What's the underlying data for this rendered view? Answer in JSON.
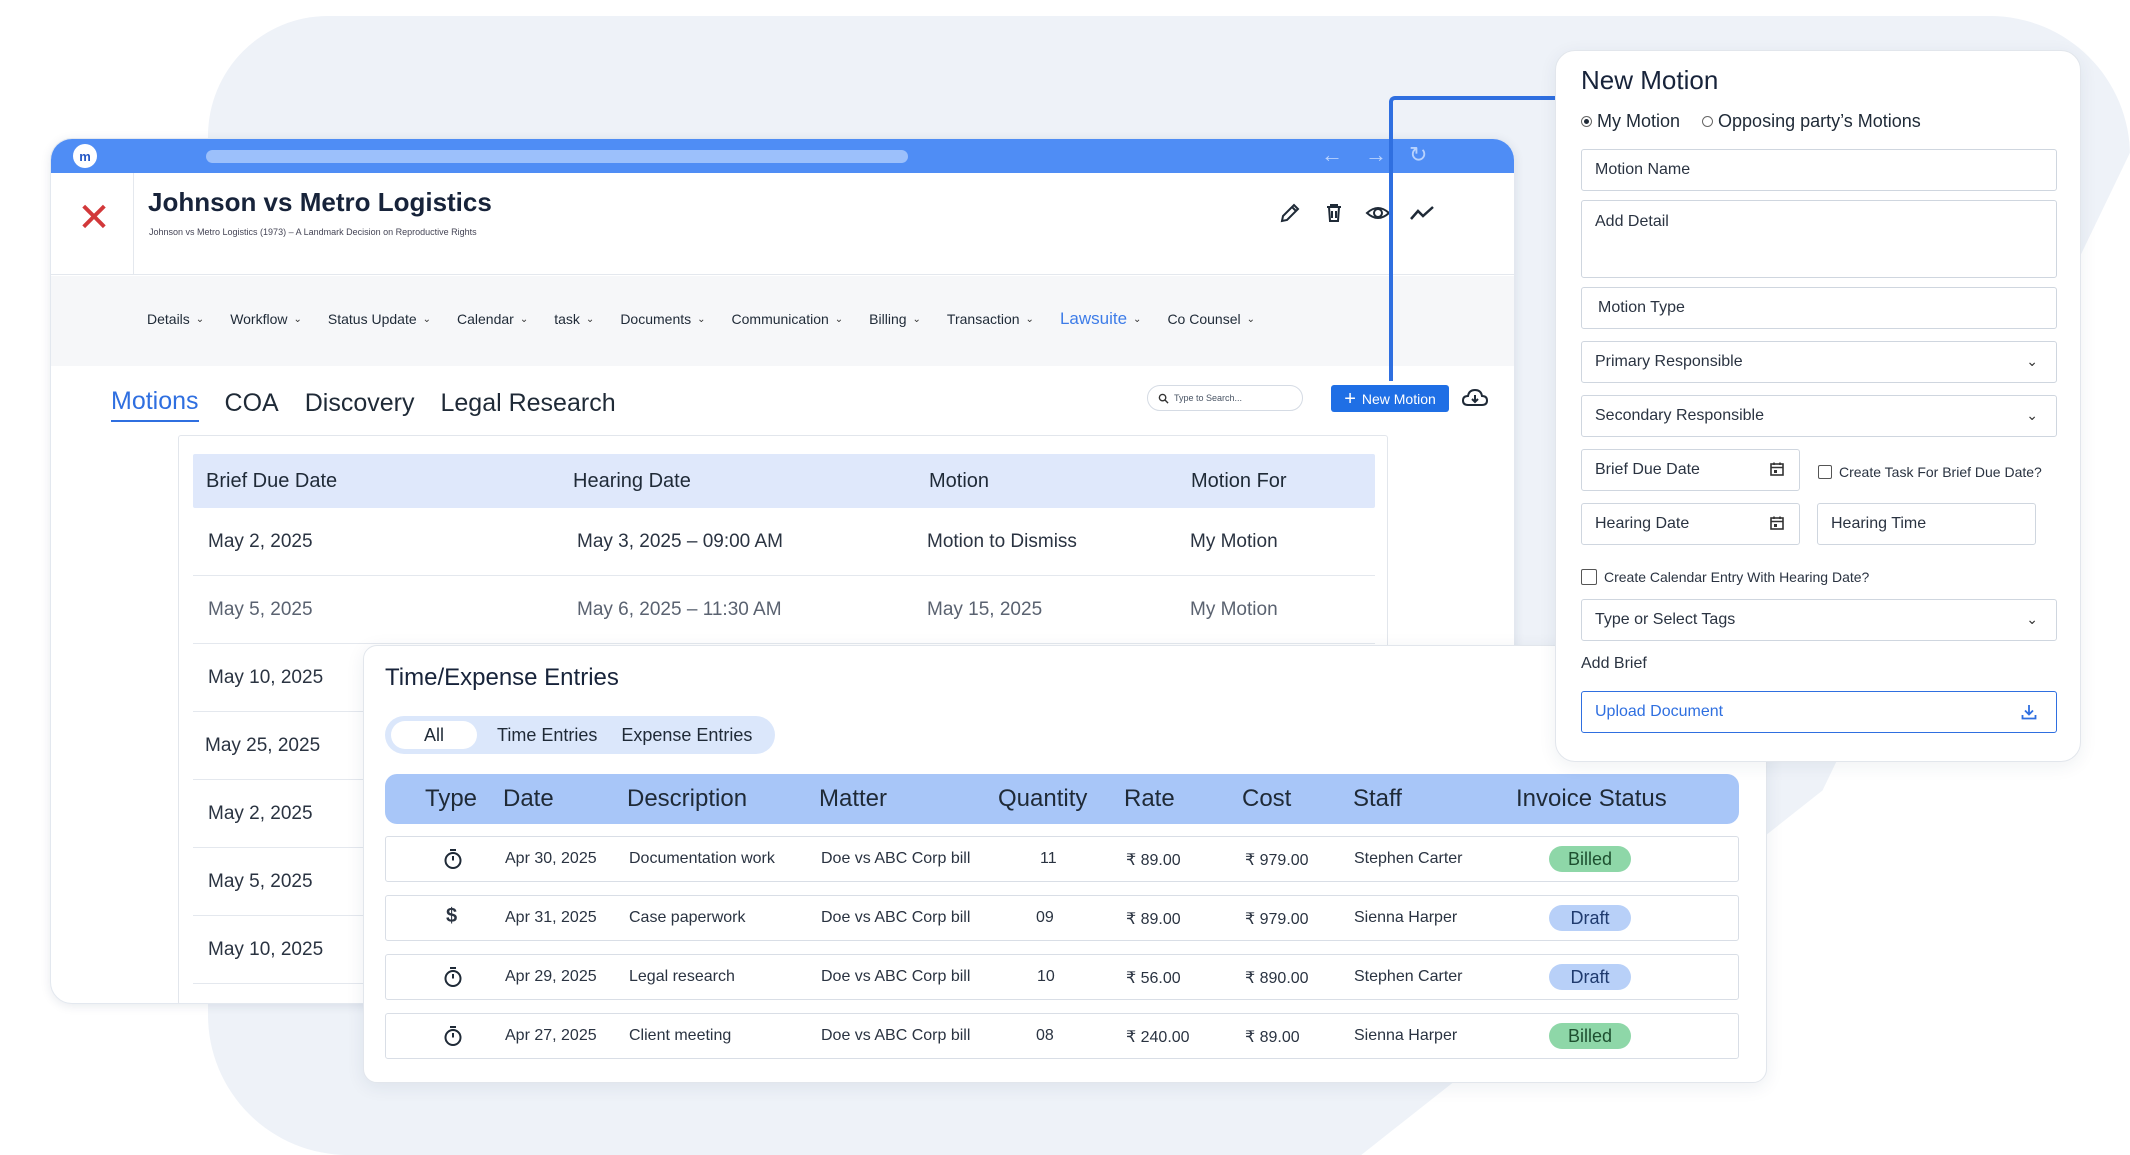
{
  "app": {
    "logo_text": "m",
    "case_title": "Johnson vs Metro Logistics",
    "case_subtitle": "Johnson vs Metro Logistics (1973) – A Landmark Decision on Reproductive Rights",
    "nav": [
      {
        "label": "Details"
      },
      {
        "label": "Workflow"
      },
      {
        "label": "Status Update"
      },
      {
        "label": "Calendar"
      },
      {
        "label": "task"
      },
      {
        "label": "Documents"
      },
      {
        "label": "Communication"
      },
      {
        "label": "Billing"
      },
      {
        "label": "Transaction"
      },
      {
        "label": "Lawsuite"
      },
      {
        "label": "Co Counsel"
      }
    ],
    "subtabs": [
      "Motions",
      "COA",
      "Discovery",
      "Legal Research"
    ],
    "search_placeholder": "Type to Search...",
    "new_motion_label": "New Motion"
  },
  "motions": {
    "headers": [
      "Brief Due Date",
      "Hearing Date",
      "Motion",
      "Motion For"
    ],
    "rows": [
      {
        "due": "May 2, 2025",
        "hearing": "May 3, 2025 – 09:00 AM",
        "motion": "Motion to Dismiss",
        "for": "My Motion"
      },
      {
        "due": "May 5, 2025",
        "hearing": "May 6, 2025 – 11:30 AM",
        "motion": "May 15, 2025",
        "for": "My Motion"
      },
      {
        "due": "May 10, 2025",
        "hearing": "",
        "motion": "",
        "for": ""
      },
      {
        "due": "May 25, 2025",
        "hearing": "",
        "motion": "",
        "for": ""
      },
      {
        "due": "May 2, 2025",
        "hearing": "",
        "motion": "",
        "for": ""
      },
      {
        "due": "May 5, 2025",
        "hearing": "",
        "motion": "",
        "for": ""
      },
      {
        "due": "May 10, 2025",
        "hearing": "",
        "motion": "",
        "for": ""
      }
    ]
  },
  "time_expense": {
    "title": "Time/Expense Entries",
    "filters": [
      "All",
      "Time Entries",
      "Expense Entries"
    ],
    "headers": [
      "Type",
      "Date",
      "Description",
      "Matter",
      "Quantity",
      "Rate",
      "Cost",
      "Staff",
      "Invoice Status"
    ],
    "rows": [
      {
        "type_icon": "timer-icon",
        "date": "Apr 30, 2025",
        "description": "Documentation work",
        "matter": "Doe vs ABC Corp bill",
        "quantity": "11",
        "rate": "₹ 89.00",
        "cost": "₹ 979.00",
        "staff": "Stephen Carter",
        "status": "Billed"
      },
      {
        "type_icon": "dollar-icon",
        "date": "Apr 31, 2025",
        "description": "Case paperwork",
        "matter": "Doe vs ABC Corp bill",
        "quantity": "09",
        "rate": "₹ 89.00",
        "cost": "₹ 979.00",
        "staff": "Sienna Harper",
        "status": "Draft"
      },
      {
        "type_icon": "timer-icon",
        "date": "Apr 29, 2025",
        "description": "Legal research",
        "matter": "Doe vs ABC Corp bill",
        "quantity": "10",
        "rate": "₹ 56.00",
        "cost": "₹ 890.00",
        "staff": "Stephen Carter",
        "status": "Draft"
      },
      {
        "type_icon": "timer-icon",
        "date": "Apr 27, 2025",
        "description": "Client meeting",
        "matter": "Doe vs ABC Corp bill",
        "quantity": "08",
        "rate": "₹ 240.00",
        "cost": "₹ 89.00",
        "staff": "Sienna Harper",
        "status": "Billed"
      }
    ]
  },
  "form": {
    "title": "New Motion",
    "radio_my": "My Motion",
    "radio_opposing": "Opposing party’s Motions",
    "motion_name": "Motion Name",
    "add_detail": "Add Detail",
    "motion_type": "Motion Type",
    "primary_responsible": "Primary Responsible",
    "secondary_responsible": "Secondary Responsible",
    "brief_due_date": "Brief Due Date",
    "create_task_label": "Create  Task For Brief Due Date?",
    "hearing_date": "Hearing Date",
    "hearing_time": "Hearing Time",
    "create_calendar_label": "Create Calendar Entry With Hearing Date?",
    "tags": "Type or Select Tags",
    "add_brief": "Add Brief",
    "upload": "Upload Document"
  },
  "colors": {
    "accent": "#2f6fe0",
    "topbar": "#4f8df5",
    "close": "#d2383a",
    "billed": "#8ed7a8",
    "draft": "#b8d0f8"
  }
}
